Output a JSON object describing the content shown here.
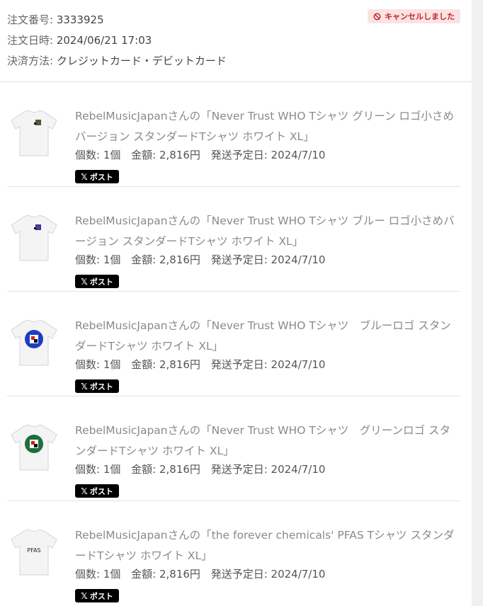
{
  "order": {
    "number_label": "注文番号:",
    "number": "3333925",
    "date_label": "注文日時:",
    "date": "2024/06/21 17:03",
    "payment_label": "決済方法:",
    "payment": "クレジットカード・デビットカード",
    "status": "キャンセルしました",
    "status_color": "#c1272d",
    "status_bg": "#fbe3e3"
  },
  "items": [
    {
      "title": "RebelMusicJapanさんの「Never Trust WHO Tシャツ グリーン ロゴ小さめバージョン スタンダードTシャツ ホワイト XL」",
      "quantity": "個数: 1個",
      "price": "金額: 2,816円",
      "ship": "発送予定日: 2024/7/10",
      "post_label": "ポスト",
      "thumb_icon": "tshirt-green-small-logo"
    },
    {
      "title": "RebelMusicJapanさんの「Never Trust WHO Tシャツ ブルー ロゴ小さめバージョン スタンダードTシャツ ホワイト XL」",
      "quantity": "個数: 1個",
      "price": "金額: 2,816円",
      "ship": "発送予定日: 2024/7/10",
      "post_label": "ポスト",
      "thumb_icon": "tshirt-blue-small-logo"
    },
    {
      "title": "RebelMusicJapanさんの「Never Trust WHO Tシャツ　ブルーロゴ スタンダードTシャツ ホワイト XL」",
      "quantity": "個数: 1個",
      "price": "金額: 2,816円",
      "ship": "発送予定日: 2024/7/10",
      "post_label": "ポスト",
      "thumb_icon": "tshirt-blue-logo"
    },
    {
      "title": "RebelMusicJapanさんの「Never Trust WHO Tシャツ　グリーンロゴ スタンダードTシャツ ホワイト XL」",
      "quantity": "個数: 1個",
      "price": "金額: 2,816円",
      "ship": "発送予定日: 2024/7/10",
      "post_label": "ポスト",
      "thumb_icon": "tshirt-green-logo"
    },
    {
      "title": "RebelMusicJapanさんの「the forever chemicals' PFAS Tシャツ スタンダードTシャツ ホワイト XL」",
      "quantity": "個数: 1個",
      "price": "金額: 2,816円",
      "ship": "発送予定日: 2024/7/10",
      "post_label": "ポスト",
      "thumb_icon": "tshirt-pfas",
      "thumb_text": "PFAS"
    }
  ]
}
